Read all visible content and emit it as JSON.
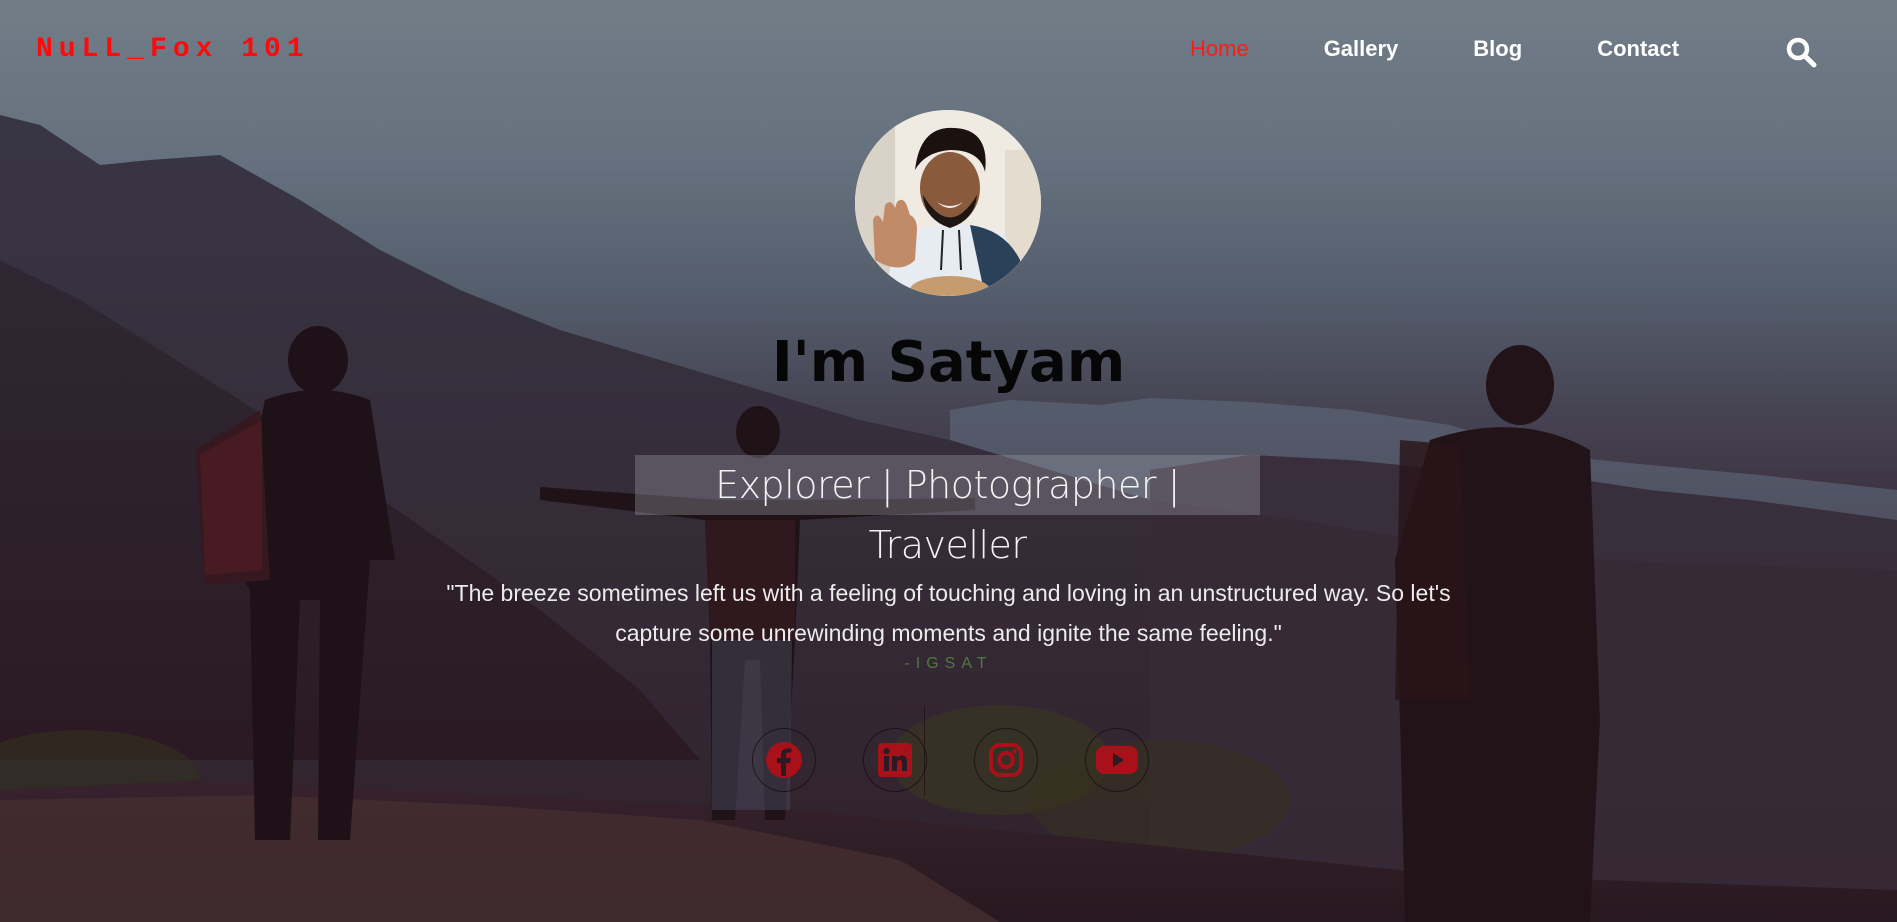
{
  "brand": {
    "logo_text": "NuLL_Fox 101",
    "accent_color": "#ff0a0a"
  },
  "nav": {
    "items": [
      {
        "label": "Home",
        "active": true
      },
      {
        "label": "Gallery",
        "active": false
      },
      {
        "label": "Blog",
        "active": false
      },
      {
        "label": "Contact",
        "active": false
      }
    ],
    "search_icon": "search-icon"
  },
  "hero": {
    "avatar_icon": "profile-photo",
    "name": "I'm Satyam",
    "tagline": "Explorer | Photographer | Traveller",
    "quote_line1": "\"The breeze sometimes left us with a feeling of touching and loving in an unstructured way. So let's",
    "quote_line2": "capture some unrewinding moments and ignite the same feeling.\"",
    "quote_author": "-IGSAT"
  },
  "social": [
    {
      "name": "facebook",
      "icon": "facebook-icon"
    },
    {
      "name": "linkedin",
      "icon": "linkedin-icon"
    },
    {
      "name": "instagram",
      "icon": "instagram-icon"
    },
    {
      "name": "youtube",
      "icon": "youtube-icon"
    }
  ],
  "colors": {
    "icon_red": "#a8101a",
    "author_green": "#4f7a3a"
  }
}
